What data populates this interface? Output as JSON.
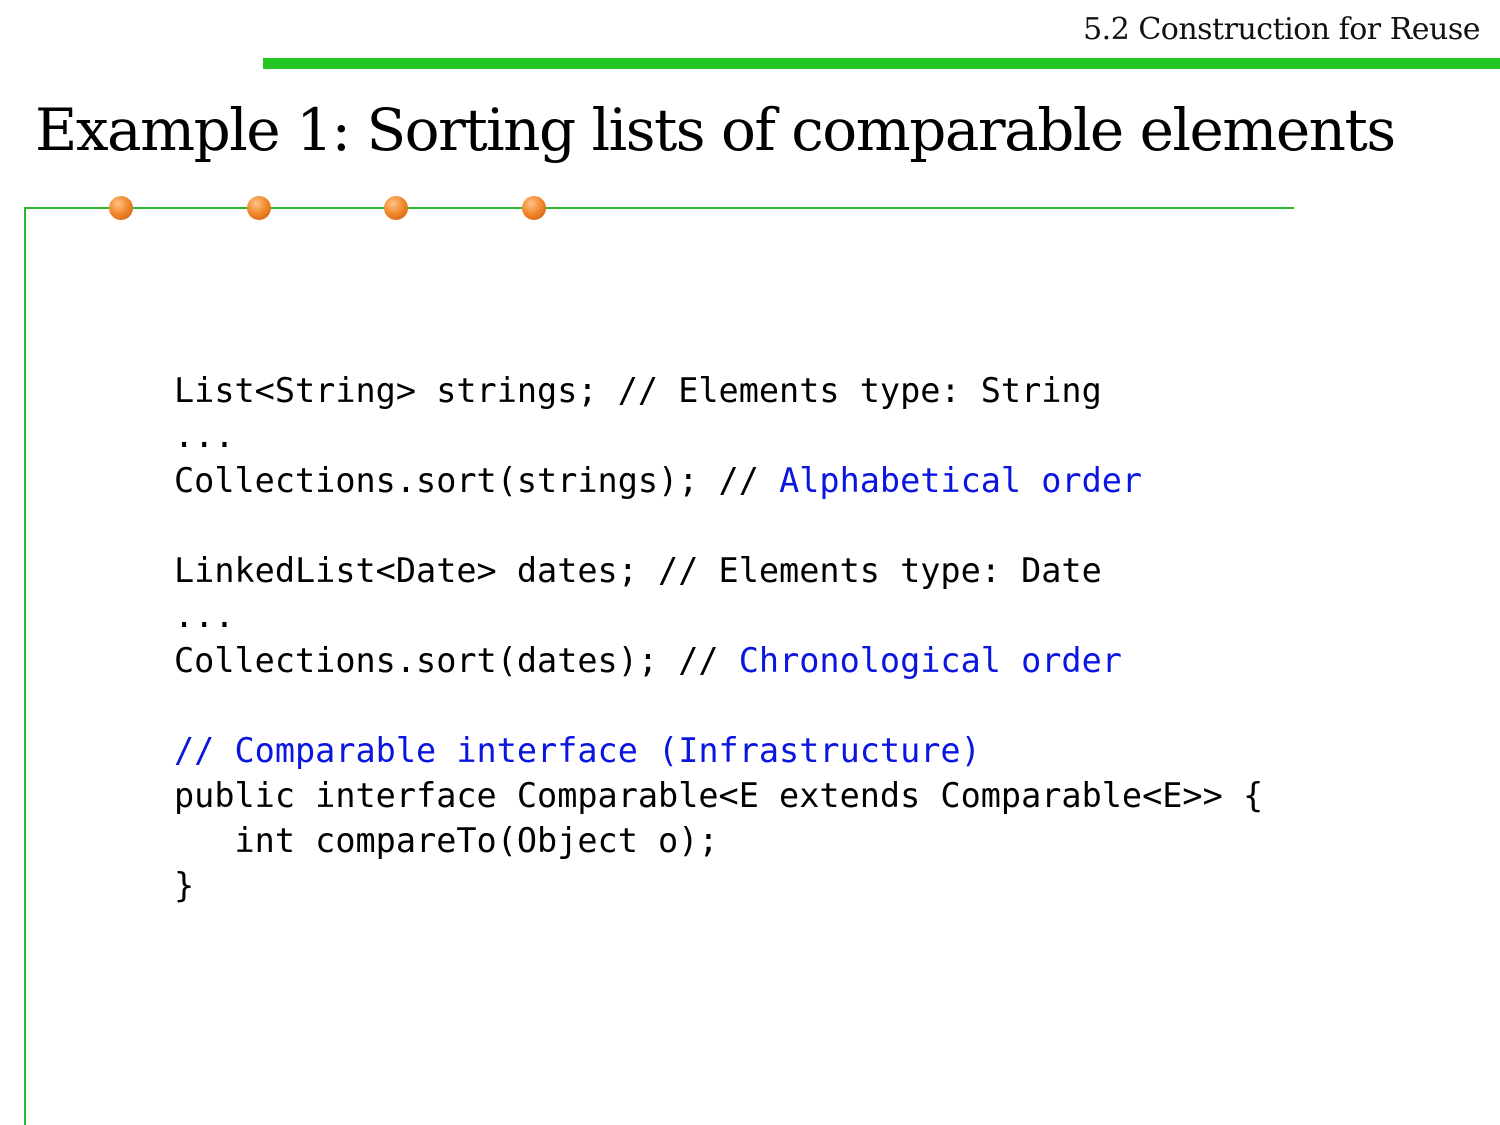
{
  "header": {
    "section_title": "5.2 Construction for Reuse"
  },
  "slide": {
    "title": "Example 1: Sorting lists of comparable elements"
  },
  "code": {
    "line1": "List<String> strings; // Elements type: String",
    "line2": "...",
    "line3_code": "Collections.sort(strings); // ",
    "line3_comment": "Alphabetical order",
    "line4": "LinkedList<Date> dates; // Elements type: Date",
    "line5": "...",
    "line6_code": "Collections.sort(dates); // ",
    "line6_comment": "Chronological order",
    "line7_comment": "// Comparable interface (Infrastructure)",
    "line8": "public interface Comparable<E extends Comparable<E>> {",
    "line9": "   int compareTo(Object o);",
    "line10": "}"
  },
  "colors": {
    "accent_green": "#22c522",
    "frame_green": "#2eb82e",
    "comment_blue": "#0a16e0",
    "bullet_orange": "#f28a2e"
  }
}
